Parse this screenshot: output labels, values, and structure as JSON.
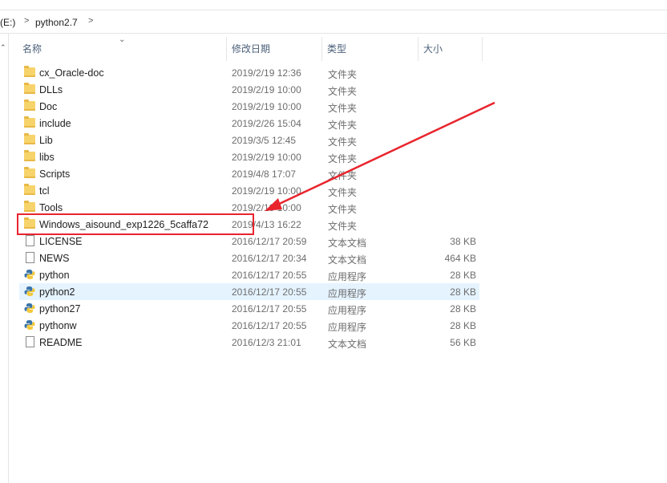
{
  "address": {
    "drive": "(E:)",
    "sep": ">",
    "folder": "python2.7",
    "chevron": "⌄"
  },
  "columns": {
    "name": "名称",
    "date": "修改日期",
    "type": "类型",
    "size": "大小"
  },
  "colors": {
    "folder": "#f7d36b",
    "selected": "#e5f3ff",
    "annotation": "#e8242d",
    "header_text": "#4c607a"
  },
  "files": [
    {
      "name": "cx_Oracle-doc",
      "date": "2019/2/19 12:36",
      "type": "文件夹",
      "size": "",
      "icon": "folder-icon"
    },
    {
      "name": "DLLs",
      "date": "2019/2/19 10:00",
      "type": "文件夹",
      "size": "",
      "icon": "folder-icon"
    },
    {
      "name": "Doc",
      "date": "2019/2/19 10:00",
      "type": "文件夹",
      "size": "",
      "icon": "folder-icon"
    },
    {
      "name": "include",
      "date": "2019/2/26 15:04",
      "type": "文件夹",
      "size": "",
      "icon": "folder-icon"
    },
    {
      "name": "Lib",
      "date": "2019/3/5 12:45",
      "type": "文件夹",
      "size": "",
      "icon": "folder-icon"
    },
    {
      "name": "libs",
      "date": "2019/2/19 10:00",
      "type": "文件夹",
      "size": "",
      "icon": "folder-icon"
    },
    {
      "name": "Scripts",
      "date": "2019/4/8 17:07",
      "type": "文件夹",
      "size": "",
      "icon": "folder-icon"
    },
    {
      "name": "tcl",
      "date": "2019/2/19 10:00",
      "type": "文件夹",
      "size": "",
      "icon": "folder-icon"
    },
    {
      "name": "Tools",
      "date": "2019/2/19 10:00",
      "type": "文件夹",
      "size": "",
      "icon": "folder-icon"
    },
    {
      "name": "Windows_aisound_exp1226_5caffa72",
      "date": "2019/4/13 16:22",
      "type": "文件夹",
      "size": "",
      "icon": "folder-icon"
    },
    {
      "name": "LICENSE",
      "date": "2016/12/17 20:59",
      "type": "文本文档",
      "size": "38 KB",
      "icon": "text-file-icon"
    },
    {
      "name": "NEWS",
      "date": "2016/12/17 20:34",
      "type": "文本文档",
      "size": "464 KB",
      "icon": "text-file-icon"
    },
    {
      "name": "python",
      "date": "2016/12/17 20:55",
      "type": "应用程序",
      "size": "28 KB",
      "icon": "python-icon"
    },
    {
      "name": "python2",
      "date": "2016/12/17 20:55",
      "type": "应用程序",
      "size": "28 KB",
      "icon": "python-icon"
    },
    {
      "name": "python27",
      "date": "2016/12/17 20:55",
      "type": "应用程序",
      "size": "28 KB",
      "icon": "python-icon"
    },
    {
      "name": "pythonw",
      "date": "2016/12/17 20:55",
      "type": "应用程序",
      "size": "28 KB",
      "icon": "python-icon"
    },
    {
      "name": "README",
      "date": "2016/12/3 21:01",
      "type": "文本文档",
      "size": "56 KB",
      "icon": "text-file-icon"
    }
  ]
}
